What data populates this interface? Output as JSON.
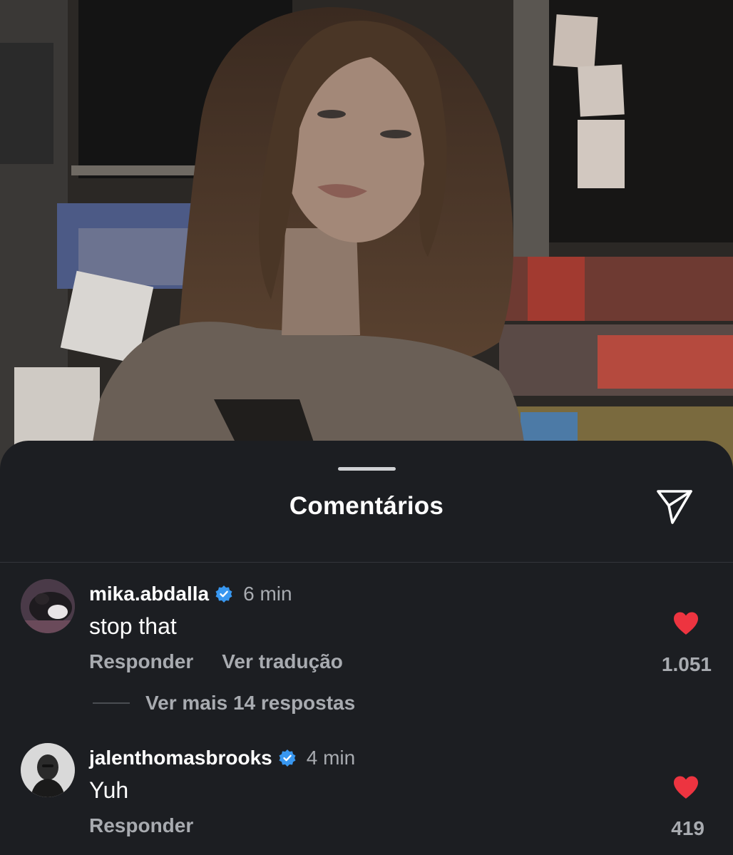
{
  "sheet": {
    "title": "Comentários",
    "share_icon": "paper-plane-icon"
  },
  "comments": [
    {
      "username": "mika.abdalla",
      "verified": true,
      "time": "6 min",
      "text": "stop that",
      "actions": [
        "Responder",
        "Ver tradução"
      ],
      "liked": true,
      "likes": "1.051",
      "more_replies": "Ver mais 14 respostas"
    },
    {
      "username": "jalenthomasbrooks",
      "verified": true,
      "time": "4 min",
      "text": "Yuh",
      "actions": [
        "Responder"
      ],
      "liked": true,
      "likes": "419"
    }
  ],
  "colors": {
    "background": "#1c1e22",
    "text_primary": "#ffffff",
    "text_secondary": "#a8abb0",
    "verified_badge": "#3897f0",
    "like_heart": "#ed3440"
  }
}
